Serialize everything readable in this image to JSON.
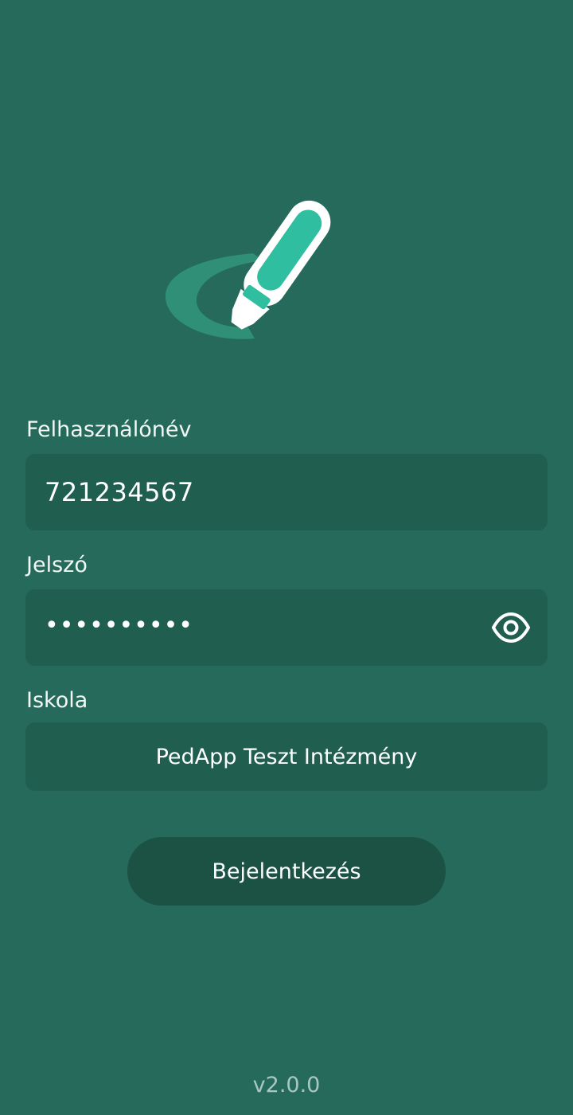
{
  "app": {
    "logo_icon": "marker-pen-icon",
    "accent_color": "#2fbfa0",
    "background_color": "#256a5b"
  },
  "form": {
    "username": {
      "label": "Felhasználónév",
      "value": "721234567"
    },
    "password": {
      "label": "Jelszó",
      "masked_value": "••••••••••",
      "toggle_icon": "eye-icon"
    },
    "school": {
      "label": "Iskola",
      "value": "PedApp Teszt Intézmény"
    },
    "submit_label": "Bejelentkezés"
  },
  "footer": {
    "version": "v2.0.0"
  }
}
